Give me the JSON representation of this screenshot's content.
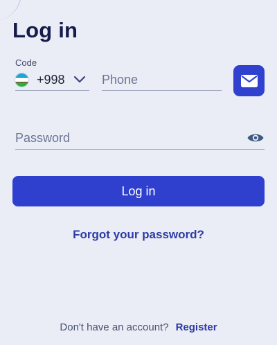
{
  "title": "Log in",
  "phone_section": {
    "code_label": "Code",
    "country_flag_icon": "uzbekistan-flag-icon",
    "dial_code": "+998",
    "phone_placeholder": "Phone",
    "switch_icon": "mail-icon"
  },
  "password_section": {
    "placeholder": "Password",
    "toggle_icon": "eye-icon"
  },
  "login_button": "Log in",
  "forgot_password": "Forgot your password?",
  "footer": {
    "no_account": "Don't have an account?",
    "register": "Register"
  },
  "colors": {
    "background": "#eaedf5",
    "primary": "#2f40cf",
    "title": "#141b4d",
    "link": "#2d3aa5"
  }
}
